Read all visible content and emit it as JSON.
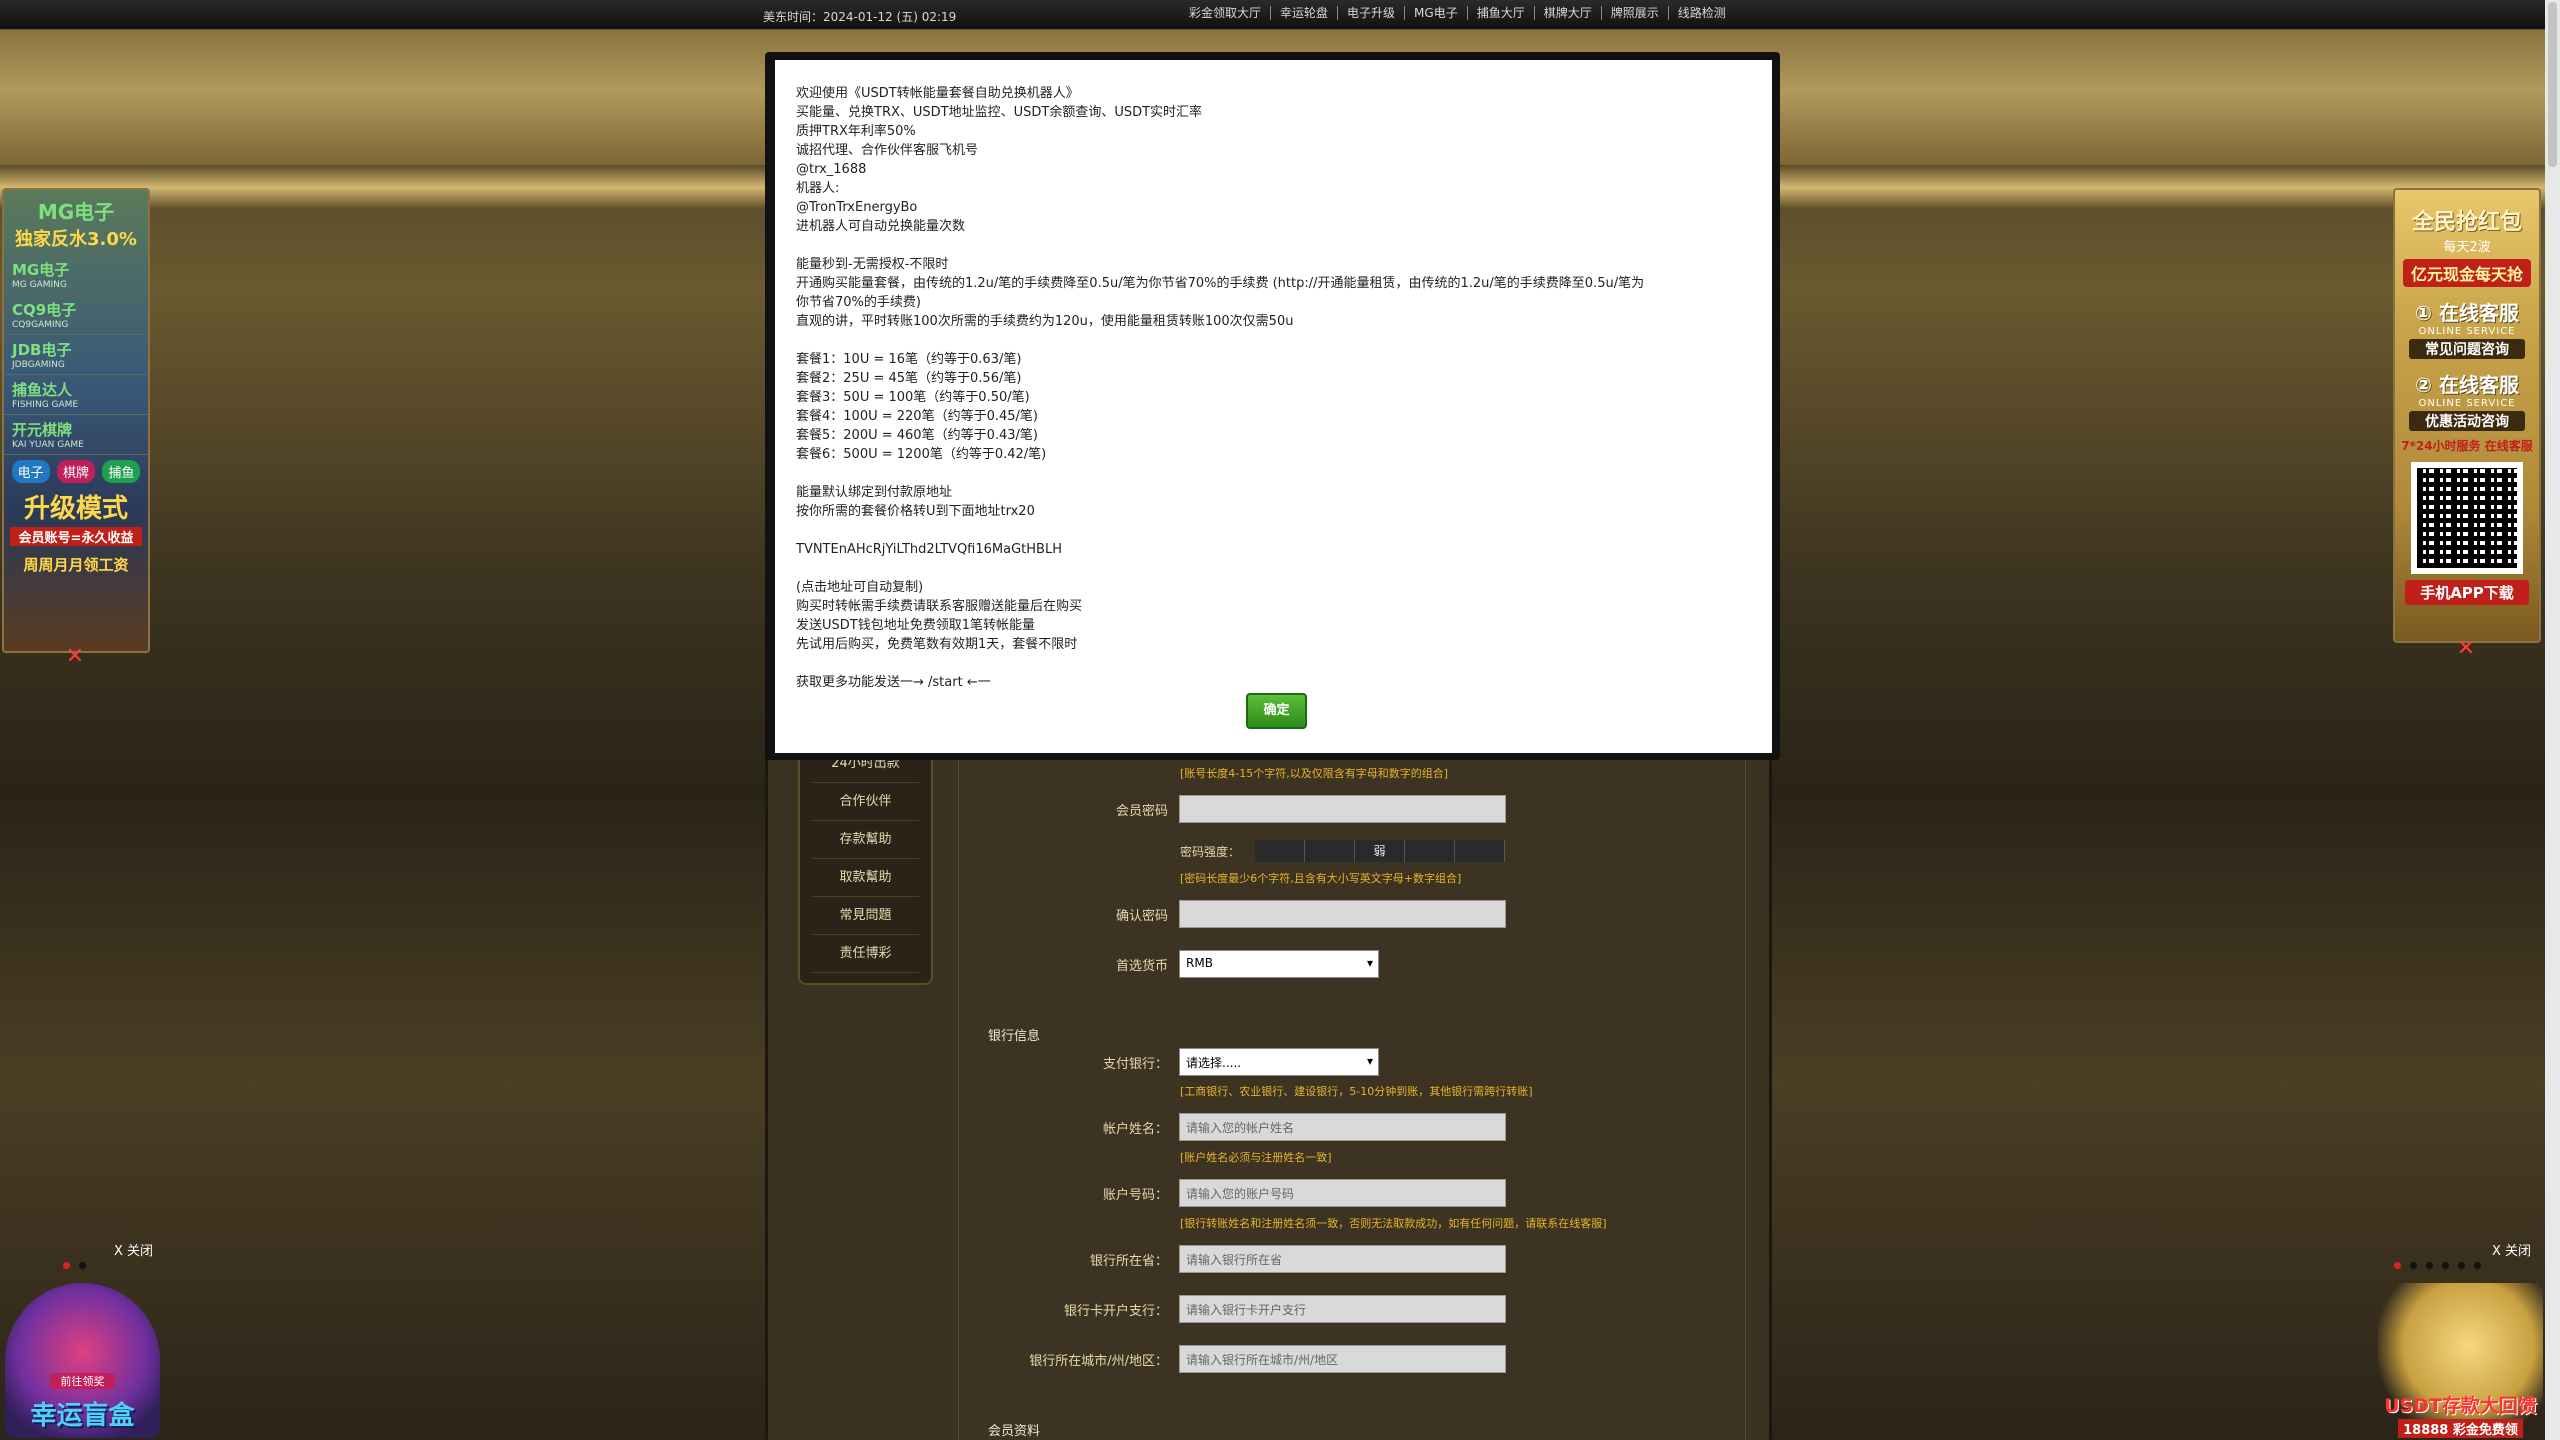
{
  "topbar": {
    "time_label": "美东时间：2024-01-12 (五) 02:19",
    "nav": [
      "彩金领取大厅",
      "幸运轮盘",
      "电子升级",
      "MG电子",
      "捕鱼大厅",
      "棋牌大厅",
      "牌照展示",
      "线路检测"
    ]
  },
  "left_menu": [
    "24小时出款",
    "合作伙伴",
    "存款幫助",
    "取款幫助",
    "常見問題",
    "责任博彩"
  ],
  "form": {
    "account_hint": "[账号长度4-15个字符,以及仅限含有字母和数字的组合]",
    "password_label": "会员密码",
    "strength_label": "密码强度：",
    "strength_value": "弱",
    "password_hint": "[密码长度最少6个字符,且含有大小写英文字母+数字组合]",
    "confirm_label": "确认密码",
    "currency_label": "首选货币",
    "currency_value": "RMB",
    "bank_section": "银行信息",
    "bank_label": "支付银行：",
    "bank_value": "请选择.....",
    "bank_hint": "[工商银行、农业银行、建设银行，5-10分钟到账，其他银行需跨行转账]",
    "holder_label": "帐户姓名：",
    "holder_placeholder": "请输入您的帐户姓名",
    "holder_hint": "[账户姓名必须与注册姓名一致]",
    "account_label": "账户号码：",
    "account_placeholder": "请输入您的账户号码",
    "account_no_hint": "[银行转账姓名和注册姓名须一致，否则无法取款成功，如有任何问题，请联系在线客服]",
    "province_label": "银行所在省：",
    "province_placeholder": "请输入银行所在省",
    "branch_label": "银行卡开户支行：",
    "branch_placeholder": "请输入银行卡开户支行",
    "city_label": "银行所在城市/州/地区：",
    "city_placeholder": "请输入银行所在城市/州/地区",
    "member_section": "会员资料"
  },
  "float_left": {
    "title": "MG电子",
    "subtitle": "独家反水3.0%",
    "items": [
      {
        "name": "MG电子",
        "en": "MG GAMING"
      },
      {
        "name": "CQ9电子",
        "en": "CQ9GAMING"
      },
      {
        "name": "JDB电子",
        "en": "JDBGAMING"
      },
      {
        "name": "捕鱼达人",
        "en": "FISHING GAME"
      },
      {
        "name": "开元棋牌",
        "en": "KAI YUAN GAME"
      }
    ],
    "tags": [
      "电子",
      "棋牌",
      "捕鱼"
    ],
    "upgrade": "升级模式",
    "forever": "会员账号=永久收益",
    "weekly": "周周月月领工资"
  },
  "float_right": {
    "title": "全民抢红包",
    "sub": "每天2波",
    "red": "亿元现金每天抢",
    "cs1": "① 在线客服",
    "en": "ONLINE SERVICE",
    "cs1_sub": "常见问题咨询",
    "cs2": "② 在线客服",
    "cs2_sub": "优惠活动咨询",
    "qq": "7*24小时服务 在线客服",
    "app": "手机APP下载"
  },
  "close_text": "X 关闭",
  "ad_left_text": "幸运盲盒",
  "ad_left_btn": "前往领奖",
  "ad_right_text": "USDT存款大回馈",
  "ad_right_sub": "18888 彩金免费领",
  "modal": {
    "lines": [
      "欢迎使用《USDT转帐能量套餐自助兑换机器人》",
      "买能量、兑换TRX、USDT地址监控、USDT余额查询、USDT实时汇率",
      "质押TRX年利率50%",
      "诚招代理、合作伙伴客服飞机号",
      "@trx_1688",
      "机器人:",
      "@TronTrxEnergyBo",
      "进机器人可自动兑换能量次数",
      "",
      "能量秒到-无需授权-不限时",
      "开通购买能量套餐，由传统的1.2u/笔的手续费降至0.5u/笔为你节省70%的手续费 (http://开通能量租赁，由传统的1.2u/笔的手续费降至0.5u/笔为",
      "你节省70%的手续费)",
      "直观的讲，平时转账100次所需的手续费约为120u，使用能量租赁转账100次仅需50u",
      "",
      "套餐1：10U = 16笔（约等于0.63/笔)",
      "套餐2：25U = 45笔（约等于0.56/笔)",
      "套餐3：50U = 100笔（约等于0.50/笔)",
      "套餐4：100U = 220笔（约等于0.45/笔)",
      "套餐5：200U = 460笔（约等于0.43/笔)",
      "套餐6：500U = 1200笔（约等于0.42/笔)",
      "",
      "能量默认绑定到付款原地址",
      "按你所需的套餐价格转U到下面地址trx20",
      "",
      "TVNTEnAHcRjYiLThd2LTVQfi16MaGtHBLH",
      "",
      "(点击地址可自动复制)",
      "购买时转帐需手续费请联系客服赠送能量后在购买",
      "发送USDT钱包地址免费领取1笔转帐能量",
      "先试用后购买，免费笔数有效期1天，套餐不限时",
      "",
      "获取更多功能发送一→ /start ←一"
    ],
    "ok_label": "确定"
  }
}
